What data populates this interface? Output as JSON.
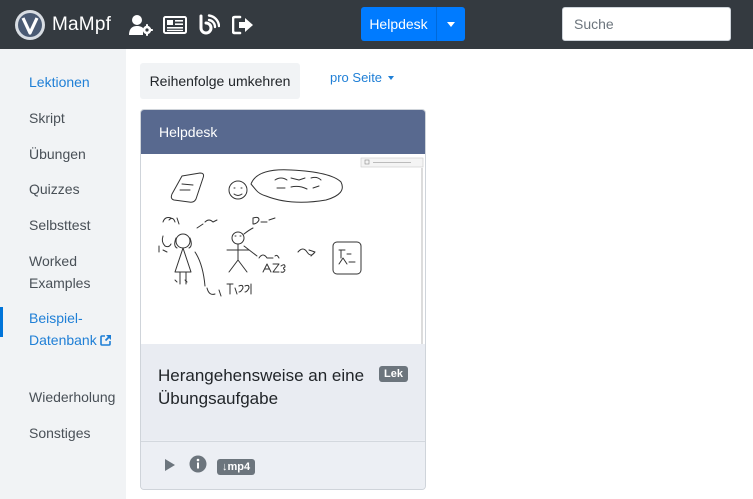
{
  "app": {
    "name": "MaMpf"
  },
  "navbar": {
    "icons": [
      "admin-user-gear-icon",
      "news-icon",
      "blog-icon",
      "logout-icon"
    ],
    "helpdesk_label": "Helpdesk",
    "search_placeholder": "Suche"
  },
  "sidebar": {
    "items": [
      {
        "label": "Lektionen"
      },
      {
        "label": "Skript"
      },
      {
        "label": "Übungen"
      },
      {
        "label": "Quizzes"
      },
      {
        "label": "Selbsttest"
      },
      {
        "label": "Worked Examples"
      },
      {
        "label": "Beispiel-Datenbank"
      },
      {
        "label": "Wiederholung"
      },
      {
        "label": "Sonstiges"
      }
    ]
  },
  "main": {
    "reverse_label": "Reihenfolge umkehren",
    "per_page_label": "pro Seite",
    "card": {
      "header": "Helpdesk",
      "title": "Herangehensweise an eine Übungsaufgabe",
      "badge": "Lek",
      "download_badge": "↓mp4"
    }
  },
  "colors": {
    "navbar": "#343a40",
    "primary": "#007bff",
    "link": "#1f7fd6",
    "card_header": "#58698f",
    "sidebar_bg": "#f1f3f5",
    "badge": "#6c757d"
  }
}
